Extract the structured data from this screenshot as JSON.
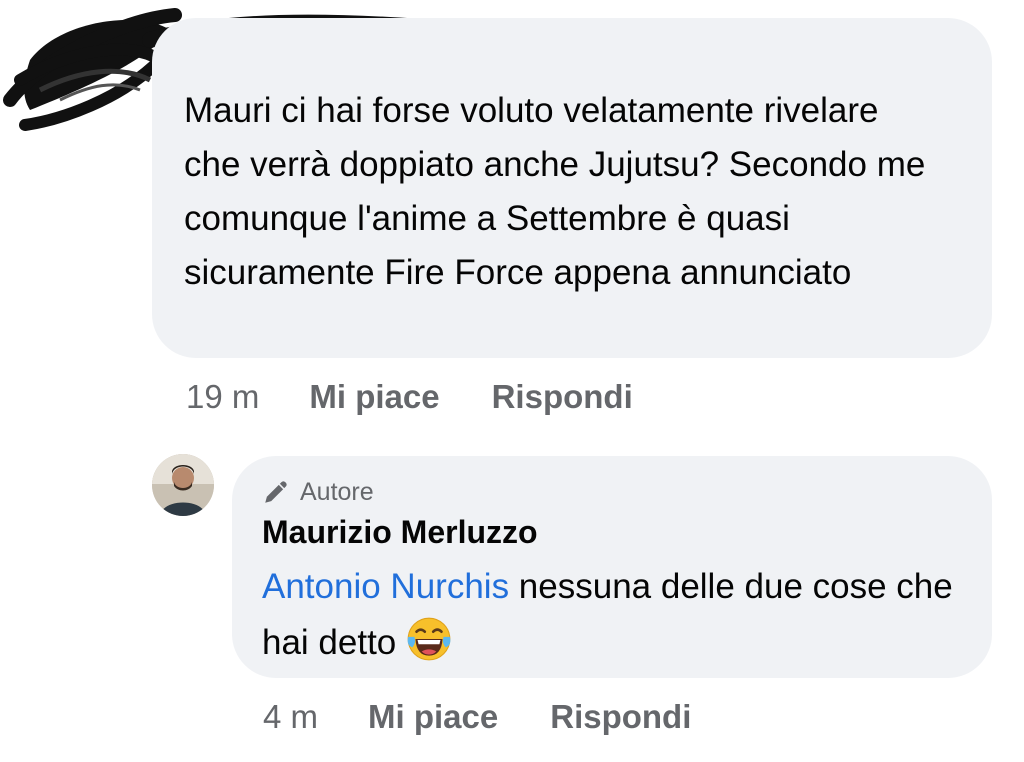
{
  "comment": {
    "text": "Mauri ci hai forse voluto velatamente rivelare che verrà doppiato anche Jujutsu? Secondo me comunque l'anime a Settembre è quasi sicuramente Fire Force appena annunciato",
    "time": "19 m",
    "like_label": "Mi piace",
    "reply_label": "Rispondi"
  },
  "reply": {
    "badge_icon": "pencil-icon",
    "badge_label": "Autore",
    "author": "Maurizio Merluzzo",
    "mention": "Antonio Nurchis",
    "text": " nessuna delle due cose che hai detto",
    "emoji": "laughing-tears-emoji",
    "time": "4 m",
    "like_label": "Mi piace",
    "reply_label": "Rispondi"
  },
  "colors": {
    "bubble": "#f0f2f5",
    "secondary_text": "#65676b",
    "mention": "#216fdb"
  }
}
